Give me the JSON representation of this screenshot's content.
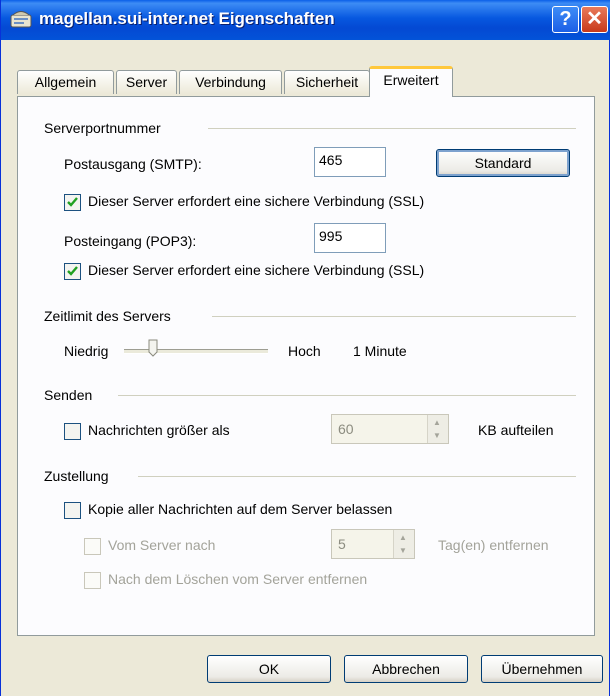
{
  "window": {
    "title": "magellan.sui-inter.net Eigenschaften",
    "help": "?",
    "close": "✕"
  },
  "tabs": [
    {
      "label": "Allgemein"
    },
    {
      "label": "Server"
    },
    {
      "label": "Verbindung"
    },
    {
      "label": "Sicherheit"
    },
    {
      "label": "Erweitert"
    }
  ],
  "active_tab": "Erweitert",
  "serverport": {
    "heading": "Serverportnummer",
    "smtp_label": "Postausgang (SMTP):",
    "smtp_value": "465",
    "standard_button": "Standard",
    "smtp_ssl_label": "Dieser Server erfordert eine sichere Verbindung (SSL)",
    "smtp_ssl_checked": true,
    "pop3_label": "Posteingang (POP3):",
    "pop3_value": "995",
    "pop3_ssl_label": "Dieser Server erfordert eine sichere Verbindung (SSL)",
    "pop3_ssl_checked": true
  },
  "timeout": {
    "heading": "Zeitlimit des Servers",
    "low_label": "Niedrig",
    "high_label": "Hoch",
    "value_text": "1 Minute",
    "slider_fraction": 0.08
  },
  "senden": {
    "heading": "Senden",
    "split_label": "Nachrichten größer als",
    "split_checked": false,
    "split_value": "60",
    "split_unit": "KB aufteilen"
  },
  "zustellung": {
    "heading": "Zustellung",
    "keep_label": "Kopie aller Nachrichten auf dem Server belassen",
    "keep_checked": false,
    "remove_after_label": "Vom Server nach",
    "remove_after_value": "5",
    "remove_after_unit": "Tag(en) entfernen",
    "remove_on_delete_label": "Nach dem Löschen vom Server entfernen"
  },
  "buttons": {
    "ok": "OK",
    "cancel": "Abbrechen",
    "apply": "Übernehmen"
  }
}
